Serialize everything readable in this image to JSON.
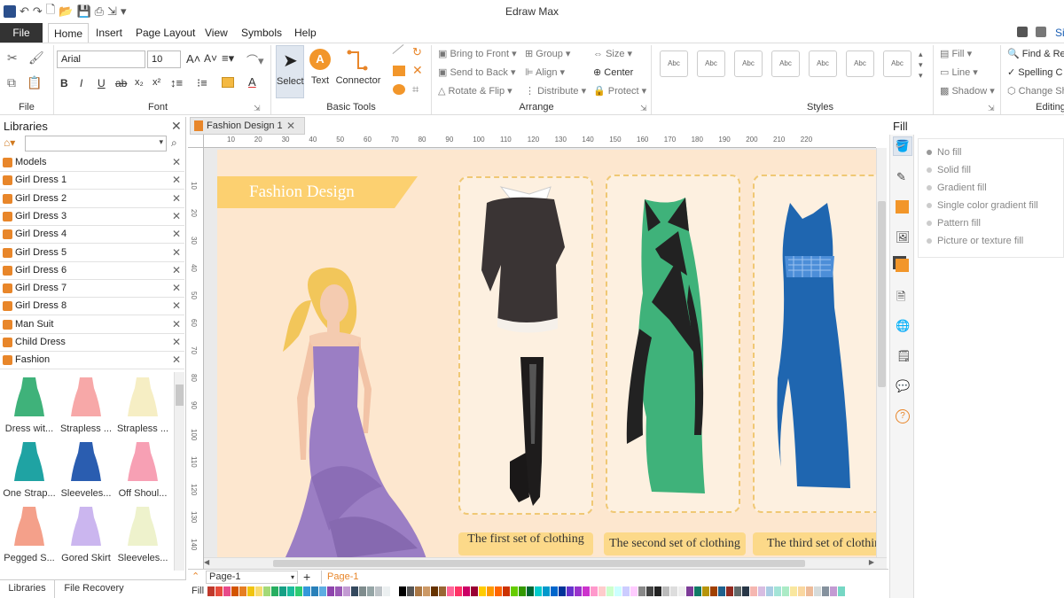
{
  "app": {
    "title": "Edraw Max"
  },
  "menu": {
    "file": "File",
    "home": "Home",
    "insert": "Insert",
    "page_layout": "Page Layout",
    "view": "View",
    "symbols": "Symbols",
    "help": "Help",
    "sign": "Si"
  },
  "ribbon": {
    "groups": {
      "file": "File",
      "font": "Font",
      "basic_tools": "Basic Tools",
      "arrange": "Arrange",
      "styles": "Styles",
      "editing": "Editing"
    },
    "font_name": "Arial",
    "font_size": "10",
    "tools": {
      "select": "Select",
      "text": "Text",
      "connector": "Connector"
    },
    "arrange": {
      "bring_to_front": "Bring to Front",
      "send_to_back": "Send to Back",
      "rotate_flip": "Rotate & Flip",
      "group": "Group",
      "align": "Align",
      "distribute": "Distribute",
      "size": "Size",
      "center": "Center",
      "protect": "Protect"
    },
    "style_label": "Abc",
    "fill": "Fill",
    "line": "Line",
    "shadow": "Shadow",
    "editing": {
      "find": "Find & Re",
      "spelling": "Spelling C",
      "change": "Change Sh"
    }
  },
  "libraries": {
    "title": "Libraries",
    "items": [
      "Models",
      "Girl Dress 1",
      "Girl Dress 2",
      "Girl Dress 3",
      "Girl Dress 4",
      "Girl Dress 5",
      "Girl Dress 6",
      "Girl Dress 7",
      "Girl Dress 8",
      "Man Suit",
      "Child Dress",
      "Fashion"
    ],
    "shapes": [
      "Dress wit...",
      "Strapless ...",
      "Strapless ...",
      "One Strap...",
      "Sleeveles...",
      "Off Shoul...",
      "Pegged S...",
      "Gored Skirt",
      "Sleeveles..."
    ],
    "bottom_tabs": [
      "Libraries",
      "File Recovery"
    ]
  },
  "document": {
    "tab": "Fashion Design 1",
    "banner": "Fashion Design",
    "captions": [
      "The first set of clothing",
      "The second set of clothing",
      "The third set of clothin"
    ],
    "ruler_h": [
      "10",
      "20",
      "30",
      "40",
      "50",
      "60",
      "70",
      "80",
      "90",
      "100",
      "110",
      "120",
      "130",
      "140",
      "150",
      "160",
      "170",
      "180",
      "190",
      "200",
      "210",
      "220"
    ],
    "ruler_v": [
      "10",
      "20",
      "30",
      "40",
      "50",
      "60",
      "70",
      "80",
      "90",
      "100",
      "110",
      "120",
      "130",
      "140"
    ],
    "page_select": "Page-1",
    "page_tab": "Page-1",
    "fill_label": "Fill"
  },
  "fill_panel": {
    "title": "Fill",
    "options": [
      "No fill",
      "Solid fill",
      "Gradient fill",
      "Single color gradient fill",
      "Pattern fill",
      "Picture or texture fill"
    ]
  },
  "colors": {
    "accent": "#e8862a",
    "page_bg": "#fde7cf",
    "banner": "#fcd070",
    "palette": [
      "#c0392b",
      "#e74c3c",
      "#e84a8a",
      "#d35400",
      "#e67e22",
      "#f1c40f",
      "#f7dc6f",
      "#a3d977",
      "#27ae60",
      "#16a085",
      "#1abc9c",
      "#2ecc71",
      "#3498db",
      "#2980b9",
      "#5dade2",
      "#8e44ad",
      "#9b59b6",
      "#c39bd3",
      "#34495e",
      "#7f8c8d",
      "#95a5a6",
      "#bdc3c7",
      "#ecf0f1",
      "#ffffff",
      "#000000",
      "#555555",
      "#aa7744",
      "#cc9966",
      "#663300",
      "#996633",
      "#ff6699",
      "#ff3366",
      "#cc0066",
      "#990033",
      "#ffcc00",
      "#ff9900",
      "#ff6600",
      "#cc3300",
      "#66cc00",
      "#339900",
      "#006633",
      "#00cccc",
      "#0099cc",
      "#0066cc",
      "#003399",
      "#6633cc",
      "#9933cc",
      "#cc33cc",
      "#ff99cc",
      "#ffcccc",
      "#ccffcc",
      "#ccffff",
      "#ccccff",
      "#ffccff",
      "#888888",
      "#444444",
      "#222222",
      "#bbbbbb",
      "#dddddd",
      "#eeeeee",
      "#7d3c98",
      "#117a65",
      "#b7950b",
      "#a04000",
      "#1f618d",
      "#922b21",
      "#616a6b",
      "#283747",
      "#f5b7b1",
      "#d7bde2",
      "#a9cce3",
      "#a3e4d7",
      "#abebc6",
      "#f9e79f",
      "#fad7a0",
      "#edbb99",
      "#d5dbdb",
      "#85929e",
      "#c39bd3",
      "#76d7c4",
      "#f0b27a",
      "#5499c7",
      "#48c9b0",
      "#52be80",
      "#f4d03f",
      "#eb984e",
      "#dc7633",
      "#cd6155",
      "#af7ac5",
      "#5dade2"
    ]
  }
}
